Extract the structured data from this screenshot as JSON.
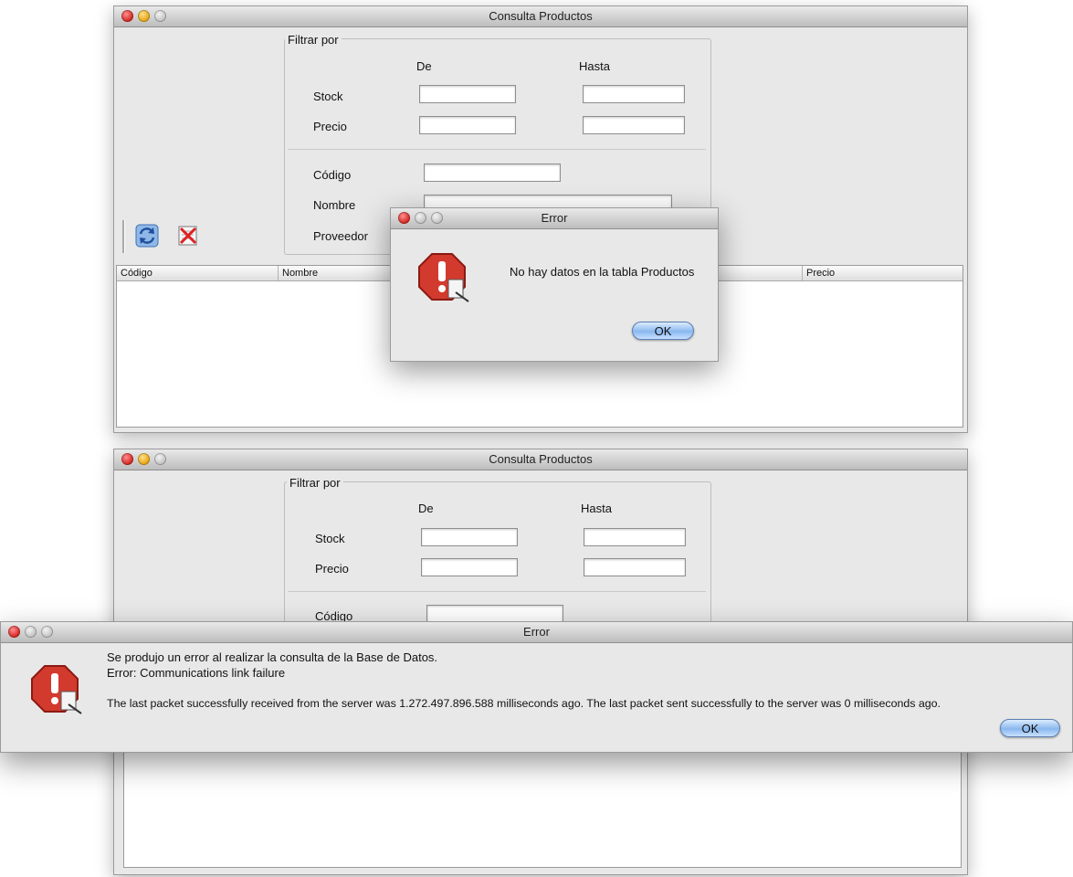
{
  "window_title": "Consulta Productos",
  "filter": {
    "group_label": "Filtrar por",
    "col_from": "De",
    "col_to": "Hasta",
    "stock_label": "Stock",
    "precio_label": "Precio",
    "codigo_label": "Código",
    "nombre_label": "Nombre",
    "proveedor_label": "Proveedor"
  },
  "toolbar": {
    "refresh_icon": "refresh-icon",
    "clear_icon": "clear-filter-icon"
  },
  "table": {
    "columns": [
      "Código",
      "Nombre",
      "Precio"
    ],
    "rows": []
  },
  "dialog1": {
    "title": "Error",
    "message": "No hay datos en la tabla Productos",
    "ok": "OK",
    "icon": "stop-alert-icon"
  },
  "dialog2": {
    "title": "Error",
    "line1": "Se produjo un error al realizar la consulta de la Base de Datos.",
    "line2": "Error: Communications link failure",
    "line3": "The last packet successfully received from the server was 1.272.497.896.588 milliseconds ago.  The last packet sent successfully to the server was 0 milliseconds ago.",
    "ok": "OK",
    "icon": "stop-alert-icon"
  }
}
